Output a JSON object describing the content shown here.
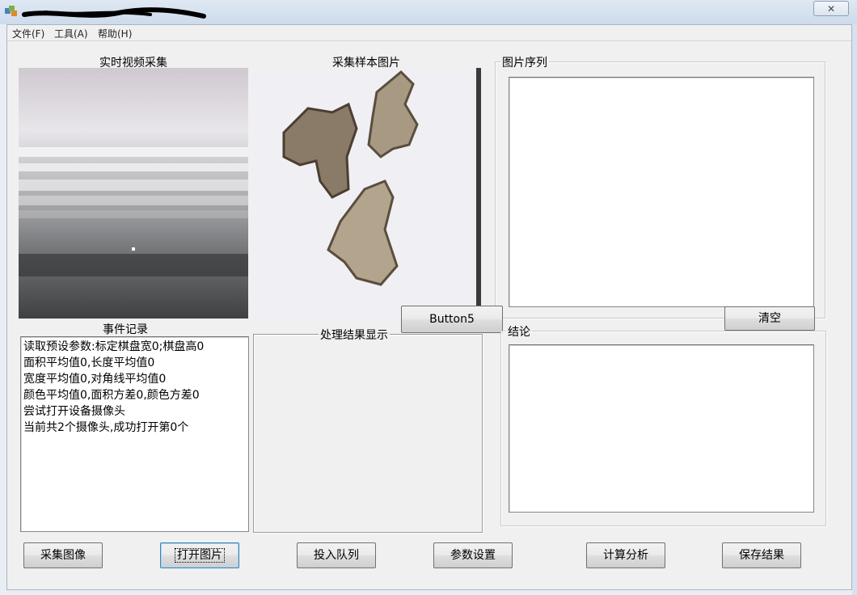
{
  "window": {
    "close_glyph": "✕"
  },
  "menu": [
    {
      "label": "文件(F)"
    },
    {
      "label": "工具(A)"
    },
    {
      "label": "帮助(H)"
    }
  ],
  "panels": {
    "live_video_label": "实时视频采集",
    "sample_image_label": "采集样本图片",
    "event_log_label": "事件记录",
    "processing_result_label": "处理结果显示",
    "image_sequence_label": "图片序列",
    "conclusion_label": "结论"
  },
  "event_log": [
    "读取预设参数:标定棋盘宽0;棋盘高0",
    "面积平均值0,长度平均值0",
    "宽度平均值0,对角线平均值0",
    "颜色平均值0,面积方差0,颜色方差0",
    "尝试打开设备摄像头",
    "当前共2个摄像头,成功打开第0个"
  ],
  "buttons": {
    "button5": "Button5",
    "clear": "清空",
    "capture": "采集图像",
    "open_image": "打开图片",
    "enqueue": "投入队列",
    "settings": "参数设置",
    "analyze": "计算分析",
    "save": "保存结果"
  }
}
